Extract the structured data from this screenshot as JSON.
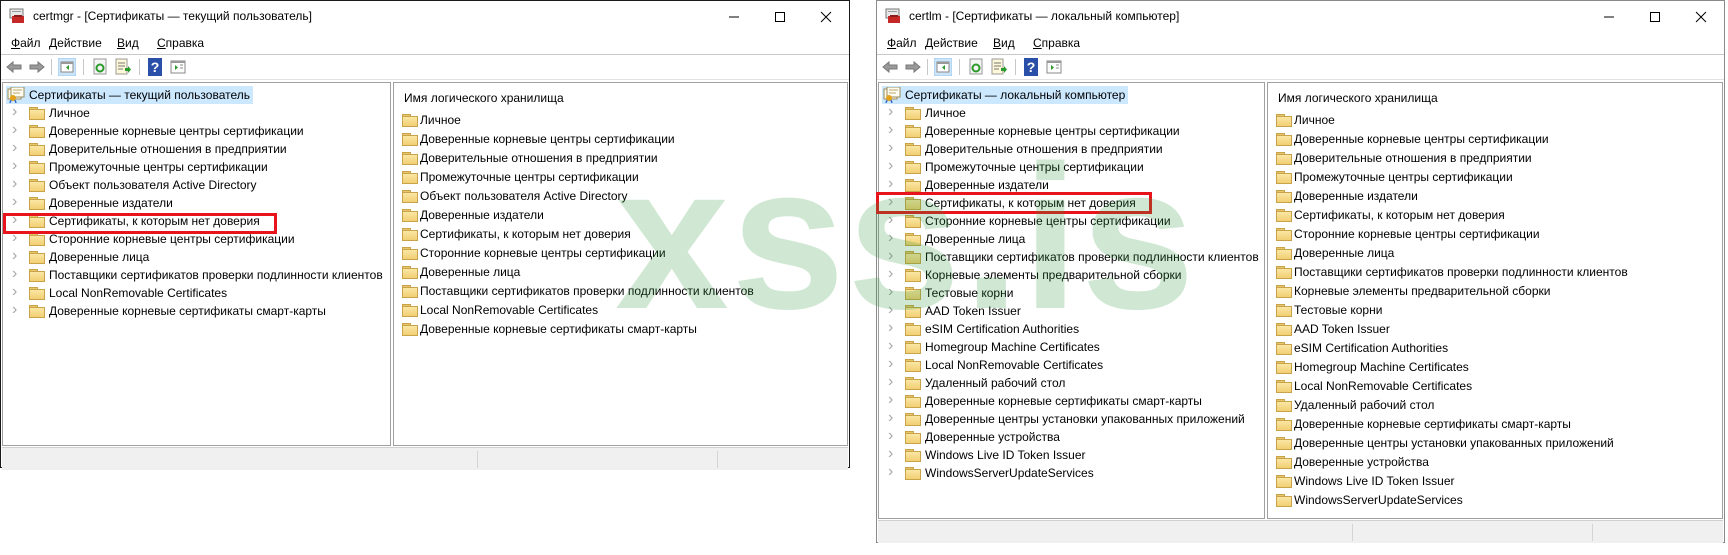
{
  "windows": [
    {
      "title": "certmgr - [Сертификаты — текущий пользователь]",
      "menu": [
        {
          "key": "Ф",
          "rest": "айл"
        },
        {
          "key": "Д",
          "rest": "ействие"
        },
        {
          "key": "В",
          "rest": "ид"
        },
        {
          "key": "С",
          "rest": "правка"
        }
      ],
      "tree_root": "Сертификаты — текущий пользователь",
      "tree_items": [
        "Личное",
        "Доверенные корневые центры сертификации",
        "Доверительные отношения в предприятии",
        "Промежуточные центры сертификации",
        "Объект пользователя Active Directory",
        "Доверенные издатели",
        "Сертификаты, к которым нет доверия",
        "Сторонние корневые центры сертификации",
        "Доверенные лица",
        "Поставщики сертификатов проверки подлинности клиентов",
        "Local NonRemovable Certificates",
        "Доверенные корневые сертификаты смарт-карты"
      ],
      "highlighted_item": "Сертификаты, к которым нет доверия",
      "list_header": "Имя логического хранилища",
      "list_items": [
        "Личное",
        "Доверенные корневые центры сертификации",
        "Доверительные отношения в предприятии",
        "Промежуточные центры сертификации",
        "Объект пользователя Active Directory",
        "Доверенные издатели",
        "Сертификаты, к которым нет доверия",
        "Сторонние корневые центры сертификации",
        "Доверенные лица",
        "Поставщики сертификатов проверки подлинности клиентов",
        "Local NonRemovable Certificates",
        "Доверенные корневые сертификаты смарт-карты"
      ]
    },
    {
      "title": "certlm - [Сертификаты — локальный компьютер]",
      "menu": [
        {
          "key": "Ф",
          "rest": "айл"
        },
        {
          "key": "Д",
          "rest": "ействие"
        },
        {
          "key": "В",
          "rest": "ид"
        },
        {
          "key": "С",
          "rest": "правка"
        }
      ],
      "tree_root": "Сертификаты — локальный компьютер",
      "tree_items": [
        "Личное",
        "Доверенные корневые центры сертификации",
        "Доверительные отношения в предприятии",
        "Промежуточные центры сертификации",
        "Доверенные издатели",
        "Сертификаты, к которым нет доверия",
        "Сторонние корневые центры сертификации",
        "Доверенные лица",
        "Поставщики сертификатов проверки подлинности клиентов",
        "Корневые элементы предварительной сборки",
        "Тестовые корни",
        "AAD Token Issuer",
        "eSIM Certification Authorities",
        "Homegroup Machine Certificates",
        "Local NonRemovable Certificates",
        "Удаленный рабочий стол",
        "Доверенные корневые сертификаты смарт-карты",
        "Доверенные центры установки упакованных приложений",
        "Доверенные устройства",
        "Windows Live ID Token Issuer",
        "WindowsServerUpdateServices"
      ],
      "highlighted_item": "Сертификаты, к которым нет доверия",
      "list_header": "Имя логического хранилища",
      "list_items": [
        "Личное",
        "Доверенные корневые центры сертификации",
        "Доверительные отношения в предприятии",
        "Промежуточные центры сертификации",
        "Доверенные издатели",
        "Сертификаты, к которым нет доверия",
        "Сторонние корневые центры сертификации",
        "Доверенные лица",
        "Поставщики сертификатов проверки подлинности клиентов",
        "Корневые элементы предварительной сборки",
        "Тестовые корни",
        "AAD Token Issuer",
        "eSIM Certification Authorities",
        "Homegroup Machine Certificates",
        "Local NonRemovable Certificates",
        "Удаленный рабочий стол",
        "Доверенные корневые сертификаты смарт-карты",
        "Доверенные центры установки упакованных приложений",
        "Доверенные устройства",
        "Windows Live ID Token Issuer",
        "WindowsServerUpdateServices"
      ]
    }
  ],
  "toolbar_icons": [
    "back-arrow-icon",
    "forward-arrow-icon",
    "show-hide-console-tree-icon",
    "refresh-icon",
    "export-list-icon",
    "help-icon",
    "show-action-pane-icon"
  ],
  "watermark": "xss.is",
  "colors": {
    "highlight_box": "#e8141c",
    "selection": "#cce8ff",
    "watermark": "#2e9b3c",
    "folder": "#f2cf73"
  }
}
